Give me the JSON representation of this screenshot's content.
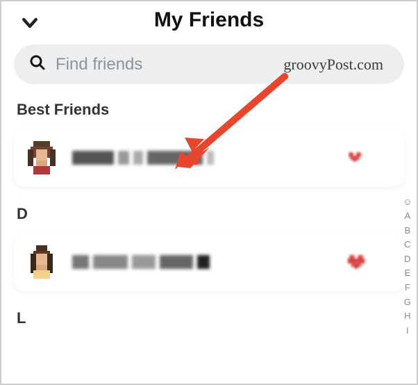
{
  "header": {
    "title": "My Friends"
  },
  "search": {
    "placeholder": "Find friends"
  },
  "watermark": "groovyPost.com",
  "sections": [
    {
      "label": "Best Friends"
    },
    {
      "label": "D"
    },
    {
      "label": "L"
    }
  ],
  "index_rail": [
    "A",
    "B",
    "C",
    "D",
    "E",
    "F",
    "G",
    "H",
    "I"
  ]
}
